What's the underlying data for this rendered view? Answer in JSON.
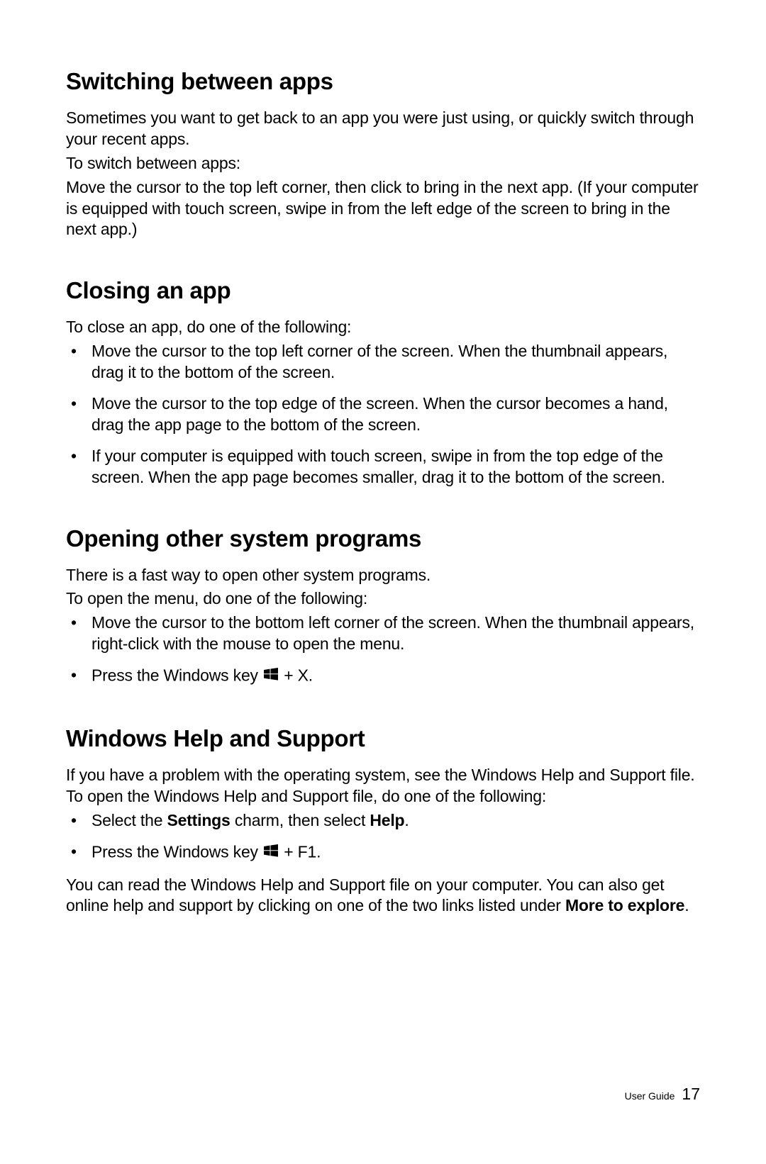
{
  "sections": {
    "switching": {
      "heading": "Switching between apps",
      "para1": "Sometimes you want to get back to an app you were just using, or quickly switch through your recent apps.",
      "para2": "To switch between apps:",
      "para3": "Move the cursor to the top left corner, then click to bring in the next app. (If your computer is equipped with touch screen, swipe in from the left edge of the screen to bring in the next app.)"
    },
    "closing": {
      "heading": "Closing an app",
      "para1": "To close an app, do one of the following:",
      "bullets": [
        "Move the cursor to the top left corner of the screen. When the thumbnail appears, drag it to the bottom of the screen.",
        "Move the cursor to the top edge of the screen. When the cursor becomes a hand, drag the app page to the bottom of the screen.",
        "If your computer is equipped with touch screen, swipe in from the top edge of the screen. When the app page becomes smaller, drag it to the bottom of the screen."
      ]
    },
    "opening": {
      "heading": "Opening other system programs",
      "para1": "There is a fast way to open other system programs.",
      "para2": "To open the menu, do one of the following:",
      "bullets": [
        "Move the cursor to the bottom left corner of the screen. When the thumbnail appears, right-click with the mouse to open the menu."
      ],
      "winkey_prefix": "Press the Windows key ",
      "winkey_suffix_x": " + X."
    },
    "help": {
      "heading": "Windows Help and Support",
      "para1": "If you have a problem with the operating system, see the Windows Help and Support file. To open the Windows Help and Support file, do one of the following:",
      "bullet1_pre": "Select the ",
      "bullet1_b1": "Settings",
      "bullet1_mid": " charm, then select ",
      "bullet1_b2": "Help",
      "bullet1_post": ".",
      "winkey_prefix": "Press the Windows key ",
      "winkey_suffix_f1": " + F1.",
      "para2_pre": "You can read the Windows Help and Support file on your computer. You can also get online help and support by clicking on one of the two links listed under ",
      "para2_bold": "More to explore",
      "para2_post": "."
    }
  },
  "footer": {
    "label": "User Guide",
    "page": "17"
  }
}
